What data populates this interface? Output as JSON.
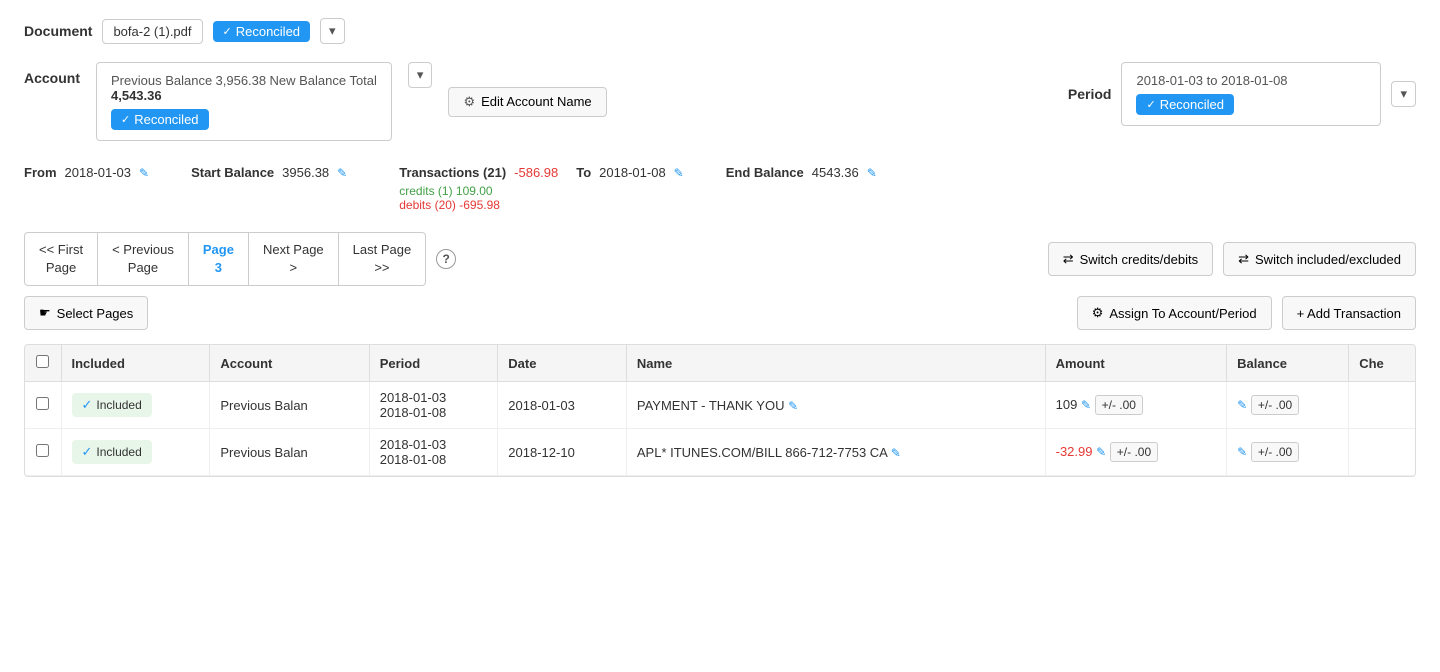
{
  "document": {
    "label": "Document",
    "filename": "bofa-2 (1).pdf",
    "badge": "Reconciled"
  },
  "account": {
    "label": "Account",
    "prev_balance_label": "Previous Balance",
    "prev_balance_value": "3,956.38",
    "new_balance_label": "New Balance Total",
    "new_balance_value": "4,543.36",
    "badge": "Reconciled",
    "edit_btn": "Edit Account Name"
  },
  "period": {
    "label": "Period",
    "dates": "2018-01-03 to 2018-01-08",
    "badge": "Reconciled"
  },
  "summary": {
    "from_label": "From",
    "from_value": "2018-01-03",
    "start_balance_label": "Start Balance",
    "start_balance_value": "3956.38",
    "transactions_label": "Transactions (21)",
    "transactions_value": "-586.98",
    "credits": "credits (1) 109.00",
    "debits": "debits (20) -695.98",
    "to_label": "To",
    "to_value": "2018-01-08",
    "end_balance_label": "End Balance",
    "end_balance_value": "4543.36"
  },
  "pagination": {
    "first": "<< First\nPage",
    "first_short": "<< First Page",
    "prev": "< Previous\nPage",
    "prev_short": "< Previous Page",
    "current": "Page\n3",
    "current_short": "Page 3",
    "next": "Next Page\n>",
    "next_short": "Next Page >",
    "last": "Last Page\n>>",
    "last_short": "Last Page >>"
  },
  "toolbar": {
    "switch_credits": "Switch credits/debits",
    "switch_included": "Switch included/excluded",
    "select_pages": "Select Pages",
    "assign": "Assign To Account/Period",
    "add_transaction": "+ Add Transaction"
  },
  "table": {
    "columns": [
      "",
      "Included",
      "Account",
      "Period",
      "Date",
      "Name",
      "Amount",
      "Balance",
      "Che"
    ],
    "rows": [
      {
        "included": "Included",
        "account": "Previous Balan",
        "period_start": "2018-01-03",
        "period_end": "2018-01-08",
        "date": "2018-01-03",
        "name": "PAYMENT - THANK YOU",
        "amount": "109",
        "amount_adj": "+/- .00",
        "balance_adj": "+/- .00"
      },
      {
        "included": "Included",
        "account": "Previous Balan",
        "period_start": "2018-01-03",
        "period_end": "2018-01-08",
        "date": "2018-12-10",
        "name": "APL* ITUNES.COM/BILL 866-712-7753 CA",
        "amount": "-32.99",
        "amount_adj": "+/- .00",
        "balance_adj": "+/- .00"
      }
    ]
  }
}
